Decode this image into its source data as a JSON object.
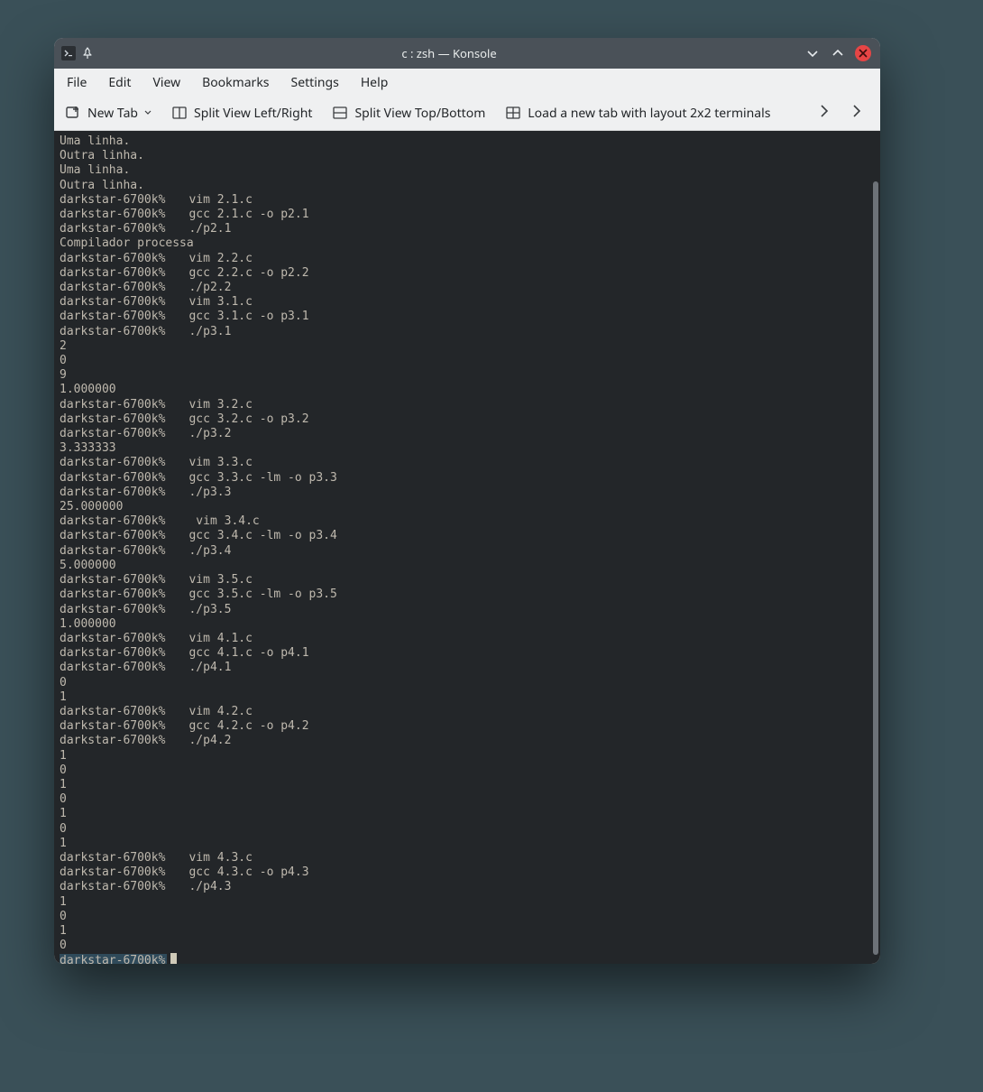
{
  "window": {
    "title": "c : zsh — Konsole"
  },
  "menu": {
    "file": "File",
    "edit": "Edit",
    "view": "View",
    "bookmarks": "Bookmarks",
    "settings": "Settings",
    "help": "Help"
  },
  "toolbar": {
    "new_tab": "New Tab",
    "split_lr": "Split View Left/Right",
    "split_tb": "Split View Top/Bottom",
    "layout_2x2": "Load a new tab with layout 2x2 terminals"
  },
  "prompt": "darkstar-6700k%",
  "terminal_lines": [
    {
      "t": "text",
      "v": "Uma linha."
    },
    {
      "t": "text",
      "v": "Outra linha."
    },
    {
      "t": "text",
      "v": "Uma linha."
    },
    {
      "t": "text",
      "v": "Outra linha."
    },
    {
      "t": "cmd",
      "v": "vim 2.1.c"
    },
    {
      "t": "cmd",
      "v": "gcc 2.1.c -o p2.1"
    },
    {
      "t": "cmd",
      "v": "./p2.1"
    },
    {
      "t": "text",
      "v": "Compilador processa"
    },
    {
      "t": "cmd",
      "v": "vim 2.2.c"
    },
    {
      "t": "cmd",
      "v": "gcc 2.2.c -o p2.2"
    },
    {
      "t": "cmd",
      "v": "./p2.2"
    },
    {
      "t": "cmd",
      "v": "vim 3.1.c"
    },
    {
      "t": "cmd",
      "v": "gcc 3.1.c -o p3.1"
    },
    {
      "t": "cmd",
      "v": "./p3.1"
    },
    {
      "t": "text",
      "v": "2"
    },
    {
      "t": "text",
      "v": "0"
    },
    {
      "t": "text",
      "v": "9"
    },
    {
      "t": "text",
      "v": "1.000000"
    },
    {
      "t": "cmd",
      "v": "vim 3.2.c"
    },
    {
      "t": "cmd",
      "v": "gcc 3.2.c -o p3.2"
    },
    {
      "t": "cmd",
      "v": "./p3.2"
    },
    {
      "t": "text",
      "v": "3.333333"
    },
    {
      "t": "cmd",
      "v": "vim 3.3.c"
    },
    {
      "t": "cmd",
      "v": "gcc 3.3.c -lm -o p3.3"
    },
    {
      "t": "cmd",
      "v": "./p3.3"
    },
    {
      "t": "text",
      "v": "25.000000"
    },
    {
      "t": "cmd",
      "v": " vim 3.4.c"
    },
    {
      "t": "cmd",
      "v": "gcc 3.4.c -lm -o p3.4"
    },
    {
      "t": "cmd",
      "v": "./p3.4"
    },
    {
      "t": "text",
      "v": "5.000000"
    },
    {
      "t": "cmd",
      "v": "vim 3.5.c"
    },
    {
      "t": "cmd",
      "v": "gcc 3.5.c -lm -o p3.5"
    },
    {
      "t": "cmd",
      "v": "./p3.5"
    },
    {
      "t": "text",
      "v": "1.000000"
    },
    {
      "t": "cmd",
      "v": "vim 4.1.c"
    },
    {
      "t": "cmd",
      "v": "gcc 4.1.c -o p4.1"
    },
    {
      "t": "cmd",
      "v": "./p4.1"
    },
    {
      "t": "text",
      "v": "0"
    },
    {
      "t": "text",
      "v": "1"
    },
    {
      "t": "cmd",
      "v": "vim 4.2.c"
    },
    {
      "t": "cmd",
      "v": "gcc 4.2.c -o p4.2"
    },
    {
      "t": "cmd",
      "v": "./p4.2"
    },
    {
      "t": "text",
      "v": "1"
    },
    {
      "t": "text",
      "v": "0"
    },
    {
      "t": "text",
      "v": "1"
    },
    {
      "t": "text",
      "v": "0"
    },
    {
      "t": "text",
      "v": "1"
    },
    {
      "t": "text",
      "v": "0"
    },
    {
      "t": "text",
      "v": "1"
    },
    {
      "t": "cmd",
      "v": "vim 4.3.c"
    },
    {
      "t": "cmd",
      "v": "gcc 4.3.c -o p4.3"
    },
    {
      "t": "cmd",
      "v": "./p4.3"
    },
    {
      "t": "text",
      "v": "1"
    },
    {
      "t": "text",
      "v": "0"
    },
    {
      "t": "text",
      "v": "1"
    },
    {
      "t": "text",
      "v": "0"
    }
  ]
}
